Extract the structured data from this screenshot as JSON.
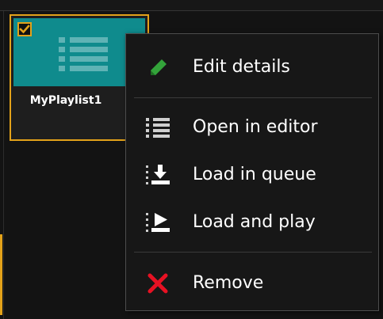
{
  "tile": {
    "name": "MyPlaylist1",
    "selected": true,
    "thumbnail_color": "#0f8b8d",
    "accent_color": "#e3a21a",
    "thumbnail_icon": "playlist-icon",
    "more_icon": "more-dots-icon"
  },
  "context_menu": {
    "items": [
      {
        "label": "Edit details",
        "icon": "pencil-icon",
        "icon_color": "#33a33a"
      },
      {
        "label": "Open in editor",
        "icon": "list-icon"
      },
      {
        "label": "Load in queue",
        "icon": "load-queue-icon"
      },
      {
        "label": "Load and play",
        "icon": "load-play-icon"
      },
      {
        "label": "Remove",
        "icon": "x-icon",
        "icon_color": "#e81123"
      }
    ]
  }
}
